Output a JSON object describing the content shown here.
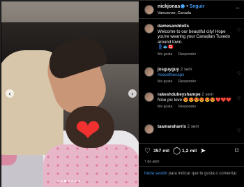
{
  "post": {
    "username": "nickjonas",
    "follow_label": "Seguir",
    "location": "Vancouver, Canada",
    "more_label": "···"
  },
  "carousel": {
    "prev_label": "‹",
    "next_label": "›",
    "slide_count": 7,
    "active_slide": 3
  },
  "comments": [
    {
      "username": "damesanddolls",
      "time": "",
      "text": "Welcome to our beautiful city! Hope you're wearing your Canadian Tuxedo around town.",
      "emoji": "👖🐟🇨🇦",
      "likes": "Me gusta",
      "reply": "Responder"
    },
    {
      "username": "josguyguy",
      "time": "2 sem",
      "text": "",
      "hashtag": "#savethecaps",
      "likes": "Me gusta",
      "reply": "Responder"
    },
    {
      "username": "rakeshdubeyshampe",
      "time": "2 sem",
      "text": "Nice pic love 😍😍😍😍😍😍❤️❤️❤️",
      "likes": "Me gusta",
      "reply": "Responder"
    },
    {
      "username": "taamaraharris",
      "time": "2 sem",
      "text": "",
      "likes": "",
      "reply": ""
    }
  ],
  "actions": {
    "likes": "357 mil",
    "comments": "1,2 mil",
    "date": "7 de abril"
  },
  "login_prompt": {
    "link": "Inicia sesión",
    "text": " para indicar que te gusta o comentar."
  },
  "colors": {
    "accent": "#4a9df8",
    "background": "#000000",
    "heart": "#f0312f"
  },
  "icons": [
    "heart-icon",
    "comment-icon",
    "share-icon",
    "bookmark-icon",
    "verified-icon",
    "more-icon",
    "chevron-left-icon",
    "chevron-right-icon"
  ]
}
